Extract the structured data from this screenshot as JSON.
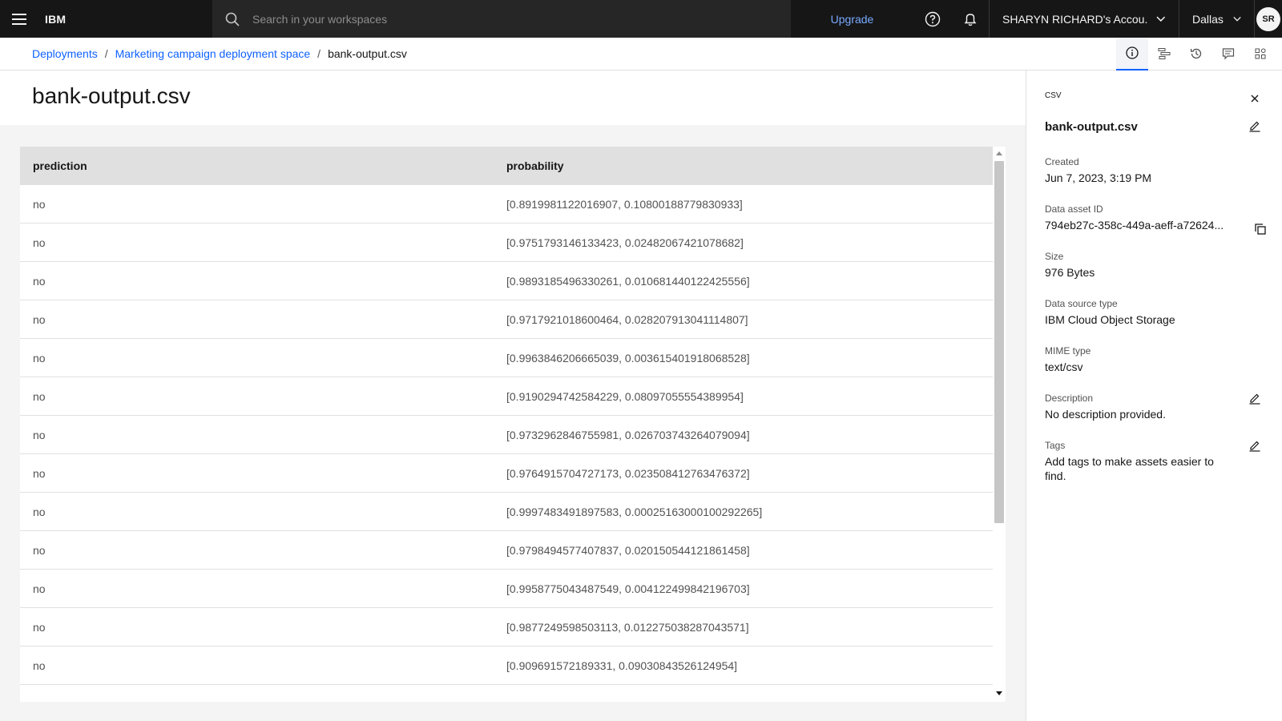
{
  "header": {
    "brand": "IBM",
    "search_placeholder": "Search in your workspaces",
    "upgrade_label": "Upgrade",
    "account_label": "SHARYN RICHARD's Accou...",
    "region_label": "Dallas",
    "avatar_initials": "SR"
  },
  "breadcrumb": {
    "items": [
      "Deployments",
      "Marketing campaign deployment space"
    ],
    "current": "bank-output.csv",
    "separator": "/"
  },
  "page": {
    "title": "bank-output.csv"
  },
  "table": {
    "columns": [
      "prediction",
      "probability"
    ],
    "rows": [
      [
        "no",
        "[0.8919981122016907, 0.10800188779830933]"
      ],
      [
        "no",
        "[0.9751793146133423, 0.02482067421078682]"
      ],
      [
        "no",
        "[0.9893185496330261, 0.010681440122425556]"
      ],
      [
        "no",
        "[0.9717921018600464, 0.028207913041114807]"
      ],
      [
        "no",
        "[0.9963846206665039, 0.003615401918068528]"
      ],
      [
        "no",
        "[0.9190294742584229, 0.08097055554389954]"
      ],
      [
        "no",
        "[0.9732962846755981, 0.026703743264079094]"
      ],
      [
        "no",
        "[0.9764915704727173, 0.023508412763476372]"
      ],
      [
        "no",
        "[0.9997483491897583, 0.00025163000100292265]"
      ],
      [
        "no",
        "[0.9798494577407837, 0.020150544121861458]"
      ],
      [
        "no",
        "[0.9958775043487549, 0.004122499842196703]"
      ],
      [
        "no",
        "[0.9877249598503113, 0.012275038287043571]"
      ],
      [
        "no",
        "[0.909691572189331, 0.09030843526124954]"
      ]
    ]
  },
  "panel": {
    "type": "CSV",
    "name": "bank-output.csv",
    "created_label": "Created",
    "created_value": "Jun 7, 2023, 3:19 PM",
    "asset_id_label": "Data asset ID",
    "asset_id_value": "794eb27c-358c-449a-aeff-a72624...",
    "size_label": "Size",
    "size_value": "976 Bytes",
    "source_label": "Data source type",
    "source_value": "IBM Cloud Object Storage",
    "mime_label": "MIME type",
    "mime_value": "text/csv",
    "description_label": "Description",
    "description_value": "No description provided.",
    "tags_label": "Tags",
    "tags_value": "Add tags to make assets easier to find."
  },
  "icons": {
    "toolbar": [
      "info-icon",
      "lineage-icon",
      "history-icon",
      "comments-icon",
      "apps-icon"
    ]
  },
  "colors": {
    "header_bg": "#161616",
    "link": "#0f62fe",
    "upgrade": "#78a9ff"
  }
}
